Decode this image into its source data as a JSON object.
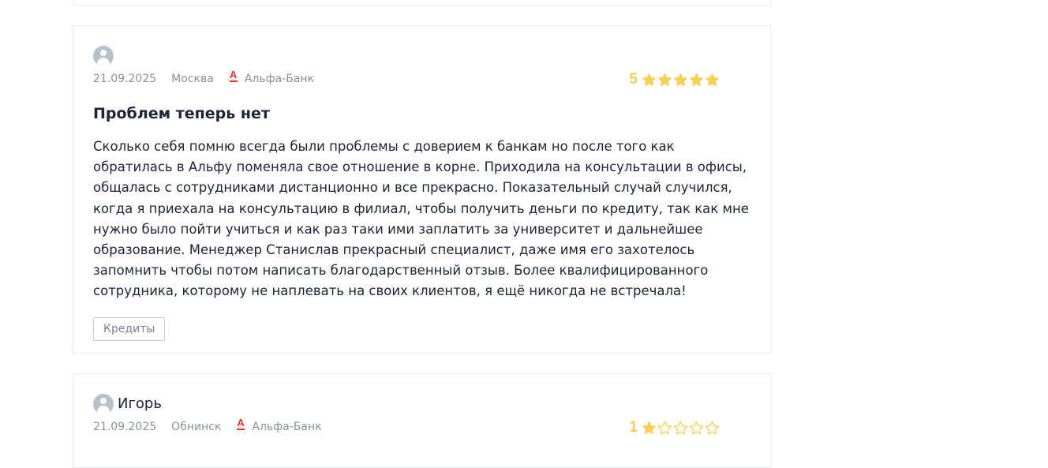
{
  "reviews": [
    {
      "author": "",
      "date": "21.09.2025",
      "city": "Москва",
      "bank": "Альфа-Банк",
      "rating": 5,
      "title": "Проблем теперь нет",
      "text": "Сколько себя помню всегда были проблемы с доверием к банкам но после того как обратилась в Альфу поменяла свое отношение в корне. Приходила на консультации в офисы, общалась с сотрудниками дистанционно и все прекрасно. Показательный случай случился, когда я приехала на консультацию в филиал, чтобы получить деньги по кредиту, так как мне нужно было пойти учиться и как раз таки ими заплатить за университет и дальнейшее образование. Менеджер Станислав прекрасный специалист, даже имя его захотелось запомнить чтобы потом написать благодарственный отзыв. Более квалифицированного сотрудника, которому не наплевать на своих клиентов, я ещё никогда не встречала!",
      "tag": "Кредиты"
    },
    {
      "author": "Игорь",
      "date": "21.09.2025",
      "city": "Обнинск",
      "bank": "Альфа-Банк",
      "rating": 1
    }
  ],
  "icons": {
    "avatar": "user-avatar-icon",
    "bank_logo": "alfa-bank-logo-icon",
    "star_filled": "star-filled-icon",
    "star_empty": "star-outline-icon"
  },
  "colors": {
    "star": "#f8cf54",
    "alfa_red": "#ef3124",
    "muted_text": "#8a909c",
    "card_border": "#e9ebef"
  }
}
